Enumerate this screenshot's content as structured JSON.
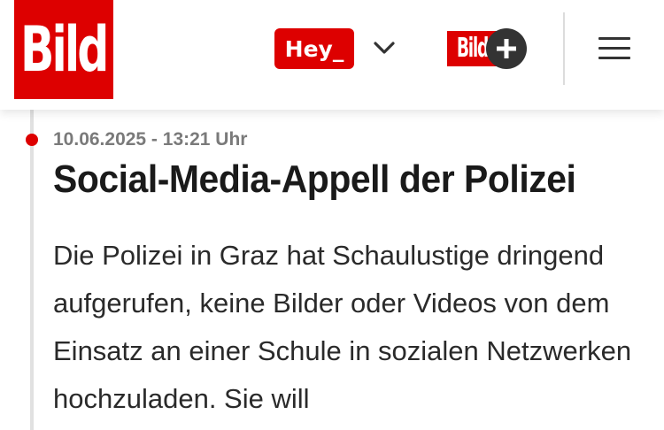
{
  "header": {
    "logo_text": "Bild",
    "hey_label": "Hey_",
    "bildplus_text": "Bild",
    "brand_color": "#dd0000"
  },
  "icons": [
    "chevron-down-icon",
    "plus-icon",
    "hamburger-menu-icon"
  ],
  "article": {
    "timestamp": "10.06.2025 - 13:21 Uhr",
    "headline": "Social-Media-Appell der Polizei",
    "body": "Die Polizei in Graz hat Schaulustige dringend aufgerufen, keine Bilder oder Videos von dem Einsatz an einer Schule in sozialen Netzwerken hochzuladen. Sie will"
  }
}
